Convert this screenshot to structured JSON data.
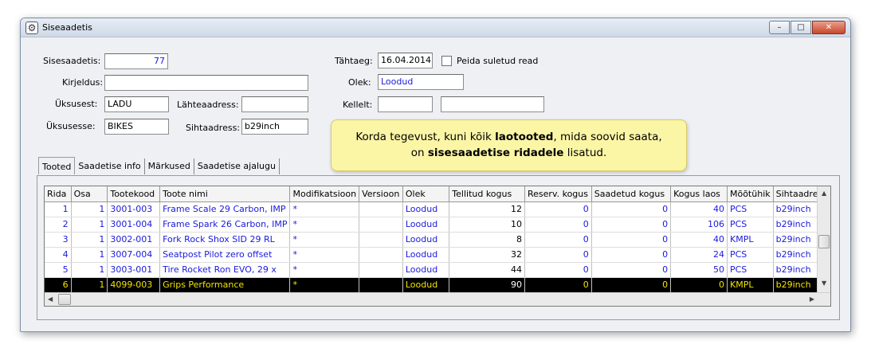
{
  "window": {
    "title": "Siseaadetis",
    "buttons": {
      "minimize": "–",
      "maximize": "□",
      "close": "✕"
    }
  },
  "form": {
    "sisesaadetis_label": "Sisesaadetis:",
    "sisesaadetis_value": "77",
    "kirjeldus_label": "Kirjeldus:",
    "kirjeldus_value": "",
    "uksusest_label": "Üksusest:",
    "uksusest_value": "LADU",
    "lahteaadress_label": "Lähteaadress:",
    "lahteaadress_value": "",
    "uksusesse_label": "Üksusesse:",
    "uksusesse_value": "BIKES",
    "sihtaadress_label": "Sihtaadress:",
    "sihtaadress_value": "b29inch",
    "tahtaeg_label": "Tähtaeg:",
    "tahtaeg_value": "16.04.2014",
    "peida_label": "Peida suletud read",
    "olek_label": "Olek:",
    "olek_value": "Loodud",
    "kellelt_label": "Kellelt:",
    "kellelt_value1": "",
    "kellelt_value2": ""
  },
  "tabs": [
    "Tooted",
    "Saadetise info",
    "Märkused",
    "Saadetise ajalugu"
  ],
  "table": {
    "columns": [
      "Rida",
      "Osa",
      "Tootekood",
      "Toote nimi",
      "Modifikatsioon",
      "Versioon",
      "Olek",
      "Tellitud kogus",
      "Reserv. kogus",
      "Saadetud kogus",
      "Kogus laos",
      "Mõõtühik",
      "Sihtaadress"
    ],
    "rows": [
      [
        "1",
        "1",
        "3001-003",
        "Frame Scale 29 Carbon, IMP",
        "*",
        "",
        "Loodud",
        "12",
        "0",
        "0",
        "40",
        "PCS",
        "b29inch"
      ],
      [
        "2",
        "1",
        "3001-004",
        "Frame Spark 26 Carbon, IMP",
        "*",
        "",
        "Loodud",
        "10",
        "0",
        "0",
        "106",
        "PCS",
        "b29inch"
      ],
      [
        "3",
        "1",
        "3002-001",
        "Fork Rock Shox SID 29 RL",
        "*",
        "",
        "Loodud",
        "8",
        "0",
        "0",
        "40",
        "KMPL",
        "b29inch"
      ],
      [
        "4",
        "1",
        "3007-004",
        "Seatpost Pilot zero offset",
        "*",
        "",
        "Loodud",
        "32",
        "0",
        "0",
        "24",
        "PCS",
        "b29inch"
      ],
      [
        "5",
        "1",
        "3003-001",
        "Tire Rocket Ron EVO, 29 x",
        "*",
        "",
        "Loodud",
        "44",
        "0",
        "0",
        "50",
        "PCS",
        "b29inch"
      ],
      [
        "6",
        "1",
        "4099-003",
        "Grips Performance",
        "*",
        "",
        "Loodud",
        "90",
        "0",
        "0",
        "0",
        "KMPL",
        "b29inch"
      ]
    ]
  },
  "tooltip": {
    "line1_a": "Korda tegevust, kuni kõik ",
    "line1_b": "laotooted",
    "line1_c": ", mida soovid saata,",
    "line2_a": "on ",
    "line2_b": "sisesaadetise ridadele",
    "line2_c": " lisatud."
  },
  "colors": {
    "value_blue": "#1a1adc",
    "selected_bg": "#000000",
    "selected_fg": "#f2e400",
    "tooltip_bg": "#fbf6a6"
  },
  "icons": [
    "app-icon",
    "minimize-icon",
    "maximize-icon",
    "close-icon",
    "scroll-up-icon",
    "scroll-down-icon",
    "scroll-left-icon",
    "scroll-right-icon"
  ]
}
